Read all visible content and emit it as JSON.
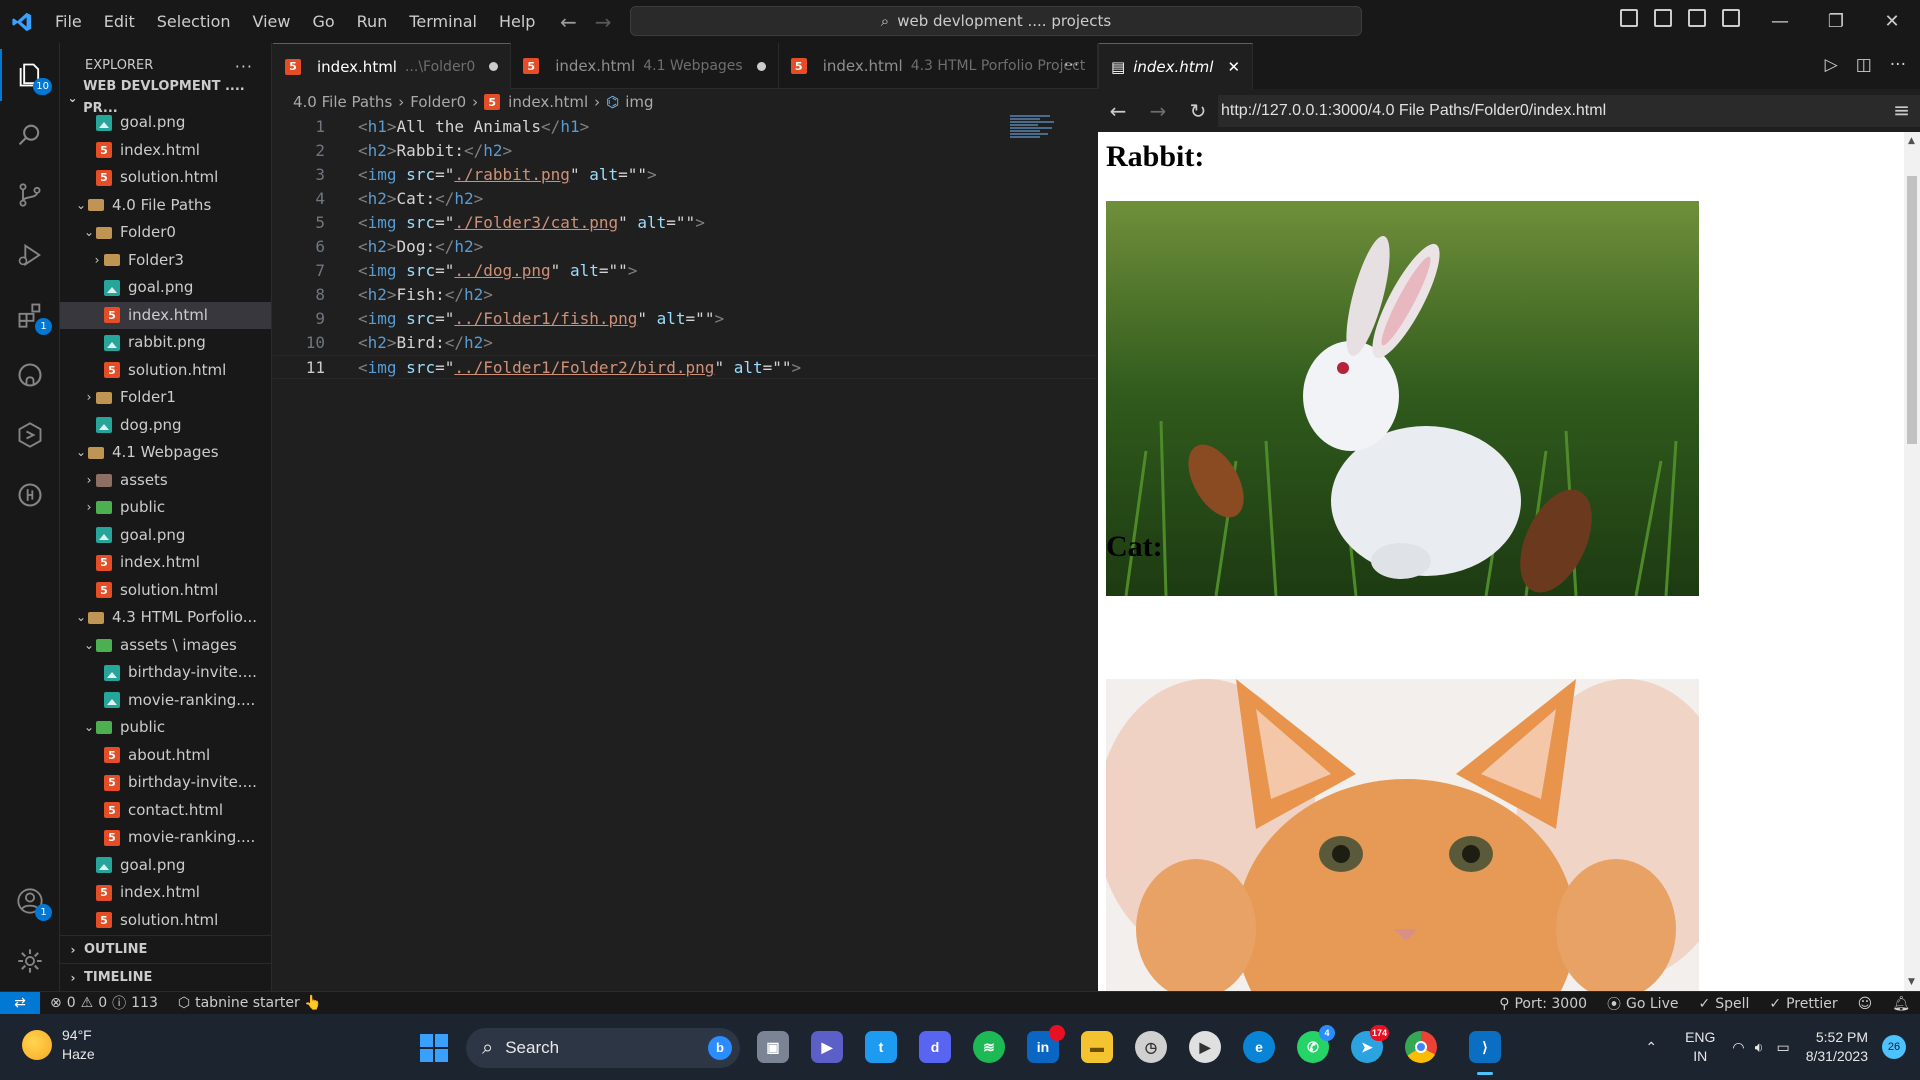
{
  "titlebar": {
    "menu": [
      "File",
      "Edit",
      "Selection",
      "View",
      "Go",
      "Run",
      "Terminal",
      "Help"
    ],
    "search": "web devlopment .... projects",
    "window_controls": [
      "—",
      "❐",
      "✕"
    ]
  },
  "activity": {
    "explorer_badge": "10",
    "extensions_badge": "1",
    "accounts_badge": "1"
  },
  "explorer": {
    "title": "EXPLORER",
    "more": "···",
    "workspace": "WEB DEVLOPMENT .... PR...",
    "tree": [
      {
        "label": "goal.png",
        "type": "img",
        "depth": 2,
        "chev": ""
      },
      {
        "label": "index.html",
        "type": "html",
        "depth": 2,
        "chev": ""
      },
      {
        "label": "solution.html",
        "type": "html",
        "depth": 2,
        "chev": ""
      },
      {
        "label": "4.0 File Paths",
        "type": "folder",
        "depth": 1,
        "chev": "⌄"
      },
      {
        "label": "Folder0",
        "type": "folder",
        "depth": 2,
        "chev": "⌄"
      },
      {
        "label": "Folder3",
        "type": "folder",
        "depth": 3,
        "chev": "›"
      },
      {
        "label": "goal.png",
        "type": "img",
        "depth": 3,
        "chev": ""
      },
      {
        "label": "index.html",
        "type": "html",
        "depth": 3,
        "chev": "",
        "selected": true
      },
      {
        "label": "rabbit.png",
        "type": "img",
        "depth": 3,
        "chev": ""
      },
      {
        "label": "solution.html",
        "type": "html",
        "depth": 3,
        "chev": ""
      },
      {
        "label": "Folder1",
        "type": "folder",
        "depth": 2,
        "chev": "›"
      },
      {
        "label": "dog.png",
        "type": "img",
        "depth": 2,
        "chev": ""
      },
      {
        "label": "4.1 Webpages",
        "type": "folder",
        "depth": 1,
        "chev": "⌄"
      },
      {
        "label": "assets",
        "type": "folder-assets",
        "depth": 2,
        "chev": "›"
      },
      {
        "label": "public",
        "type": "folder-special",
        "depth": 2,
        "chev": "›"
      },
      {
        "label": "goal.png",
        "type": "img",
        "depth": 2,
        "chev": ""
      },
      {
        "label": "index.html",
        "type": "html",
        "depth": 2,
        "chev": ""
      },
      {
        "label": "solution.html",
        "type": "html",
        "depth": 2,
        "chev": ""
      },
      {
        "label": "4.3 HTML Porfolio...",
        "type": "folder",
        "depth": 1,
        "chev": "⌄"
      },
      {
        "label": "assets \\ images",
        "type": "folder-special",
        "depth": 2,
        "chev": "⌄"
      },
      {
        "label": "birthday-invite....",
        "type": "img",
        "depth": 3,
        "chev": ""
      },
      {
        "label": "movie-ranking....",
        "type": "img",
        "depth": 3,
        "chev": ""
      },
      {
        "label": "public",
        "type": "folder-special",
        "depth": 2,
        "chev": "⌄"
      },
      {
        "label": "about.html",
        "type": "html",
        "depth": 3,
        "chev": ""
      },
      {
        "label": "birthday-invite....",
        "type": "html",
        "depth": 3,
        "chev": ""
      },
      {
        "label": "contact.html",
        "type": "html",
        "depth": 3,
        "chev": ""
      },
      {
        "label": "movie-ranking....",
        "type": "html",
        "depth": 3,
        "chev": ""
      },
      {
        "label": "goal.png",
        "type": "img",
        "depth": 2,
        "chev": ""
      },
      {
        "label": "index.html",
        "type": "html",
        "depth": 2,
        "chev": ""
      },
      {
        "label": "solution.html",
        "type": "html",
        "depth": 2,
        "chev": ""
      }
    ],
    "outline": "OUTLINE",
    "timeline": "TIMELINE"
  },
  "editor": {
    "tabs": [
      {
        "name": "index.html",
        "desc": "...\\Folder0",
        "active": true
      },
      {
        "name": "index.html",
        "desc": "4.1 Webpages",
        "active": false
      },
      {
        "name": "index.html",
        "desc": "4.3 HTML Porfolio Project",
        "active": false
      }
    ],
    "tab_more": "···",
    "breadcrumb": [
      "4.0 File Paths",
      "Folder0",
      "index.html",
      "img"
    ],
    "lines": [
      {
        "n": "1",
        "parts": [
          [
            "br",
            "<"
          ],
          [
            "tg",
            "h1"
          ],
          [
            "br",
            ">"
          ],
          [
            "tx",
            "All the Animals"
          ],
          [
            "br",
            "</"
          ],
          [
            "tg",
            "h1"
          ],
          [
            "br",
            ">"
          ]
        ]
      },
      {
        "n": "2",
        "parts": [
          [
            "br",
            "<"
          ],
          [
            "tg",
            "h2"
          ],
          [
            "br",
            ">"
          ],
          [
            "tx",
            "Rabbit:"
          ],
          [
            "br",
            "</"
          ],
          [
            "tg",
            "h2"
          ],
          [
            "br",
            ">"
          ]
        ]
      },
      {
        "n": "3",
        "parts": [
          [
            "br",
            "<"
          ],
          [
            "tg",
            "img "
          ],
          [
            "at",
            "src"
          ],
          [
            "op",
            "=\""
          ],
          [
            "st",
            "./rabbit.png"
          ],
          [
            "op",
            "\" "
          ],
          [
            "at",
            "alt"
          ],
          [
            "op",
            "=\"\""
          ],
          [
            "br",
            ">"
          ]
        ]
      },
      {
        "n": "4",
        "parts": [
          [
            "br",
            "<"
          ],
          [
            "tg",
            "h2"
          ],
          [
            "br",
            ">"
          ],
          [
            "tx",
            "Cat:"
          ],
          [
            "br",
            "</"
          ],
          [
            "tg",
            "h2"
          ],
          [
            "br",
            ">"
          ]
        ]
      },
      {
        "n": "5",
        "parts": [
          [
            "br",
            "<"
          ],
          [
            "tg",
            "img "
          ],
          [
            "at",
            "src"
          ],
          [
            "op",
            "=\""
          ],
          [
            "st",
            "./Folder3/cat.png"
          ],
          [
            "op",
            "\" "
          ],
          [
            "at",
            "alt"
          ],
          [
            "op",
            "=\"\""
          ],
          [
            "br",
            ">"
          ]
        ]
      },
      {
        "n": "6",
        "parts": [
          [
            "br",
            "<"
          ],
          [
            "tg",
            "h2"
          ],
          [
            "br",
            ">"
          ],
          [
            "tx",
            "Dog:"
          ],
          [
            "br",
            "</"
          ],
          [
            "tg",
            "h2"
          ],
          [
            "br",
            ">"
          ]
        ]
      },
      {
        "n": "7",
        "parts": [
          [
            "br",
            "<"
          ],
          [
            "tg",
            "img "
          ],
          [
            "at",
            "src"
          ],
          [
            "op",
            "=\""
          ],
          [
            "st",
            "../dog.png"
          ],
          [
            "op",
            "\" "
          ],
          [
            "at",
            "alt"
          ],
          [
            "op",
            "=\"\""
          ],
          [
            "br",
            ">"
          ]
        ]
      },
      {
        "n": "8",
        "parts": [
          [
            "br",
            "<"
          ],
          [
            "tg",
            "h2"
          ],
          [
            "br",
            ">"
          ],
          [
            "tx",
            "Fish:"
          ],
          [
            "br",
            "</"
          ],
          [
            "tg",
            "h2"
          ],
          [
            "br",
            ">"
          ]
        ]
      },
      {
        "n": "9",
        "parts": [
          [
            "br",
            "<"
          ],
          [
            "tg",
            "img "
          ],
          [
            "at",
            "src"
          ],
          [
            "op",
            "=\""
          ],
          [
            "st",
            "../Folder1/fish.png"
          ],
          [
            "op",
            "\" "
          ],
          [
            "at",
            "alt"
          ],
          [
            "op",
            "=\"\""
          ],
          [
            "br",
            ">"
          ]
        ]
      },
      {
        "n": "10",
        "parts": [
          [
            "br",
            "<"
          ],
          [
            "tg",
            "h2"
          ],
          [
            "br",
            ">"
          ],
          [
            "tx",
            "Bird:"
          ],
          [
            "br",
            "</"
          ],
          [
            "tg",
            "h2"
          ],
          [
            "br",
            ">"
          ]
        ]
      },
      {
        "n": "11",
        "parts": [
          [
            "br",
            "<"
          ],
          [
            "tg",
            "img "
          ],
          [
            "at",
            "src"
          ],
          [
            "op",
            "=\""
          ],
          [
            "st",
            "../Folder1/Folder2/bird.png"
          ],
          [
            "op",
            "\" "
          ],
          [
            "at",
            "alt"
          ],
          [
            "op",
            "=\"\""
          ],
          [
            "br",
            ">"
          ]
        ],
        "current": true
      }
    ]
  },
  "preview": {
    "tab_title": "index.html",
    "url": "http://127.0.0.1:3000/4.0 File Paths/Folder0/index.html",
    "headings": [
      "Rabbit:",
      "Cat:"
    ]
  },
  "status": {
    "errors": "0",
    "warnings": "0",
    "infos": "113",
    "tabnine": "tabnine starter 👆",
    "port": "Port: 3000",
    "golive": "Go Live",
    "spell": "Spell",
    "prettier": "Prettier"
  },
  "taskbar": {
    "temp": "94°F",
    "condition": "Haze",
    "search": "Search",
    "lang1": "ENG",
    "lang2": "IN",
    "time": "5:52 PM",
    "date": "8/31/2023",
    "notifications": "26",
    "whatsapp_badge": "4",
    "telegram_badge": "174"
  }
}
